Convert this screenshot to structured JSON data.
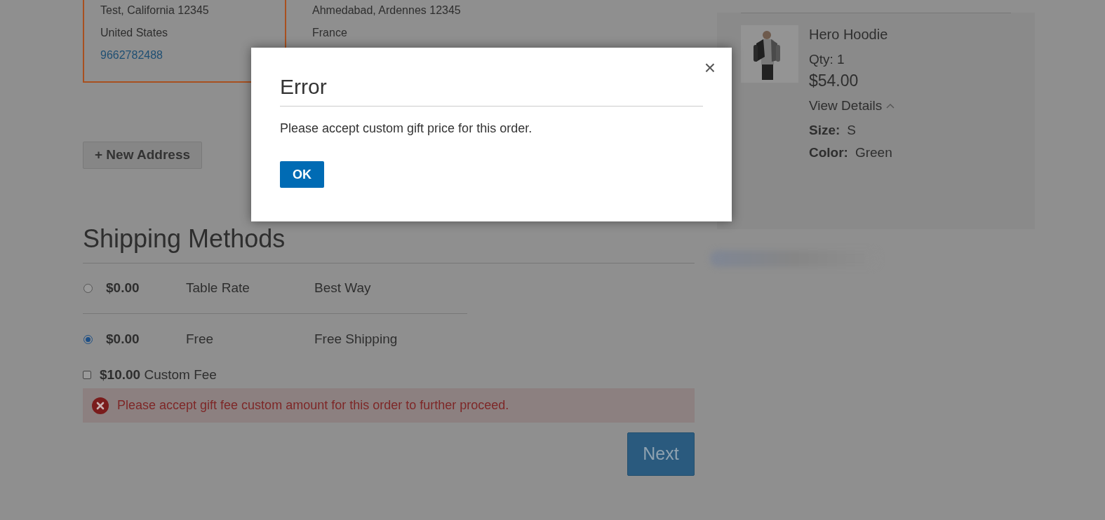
{
  "addresses": [
    {
      "lines": [
        "Test, California 12345",
        "United States"
      ],
      "phone": "9662782488",
      "selected": true
    },
    {
      "lines": [
        "Ahmedabad, Ardennes 12345",
        "France"
      ],
      "selected": false
    }
  ],
  "new_address_button": "+ New Address",
  "shipping": {
    "title": "Shipping Methods",
    "methods": [
      {
        "price": "$0.00",
        "carrier": "Table Rate",
        "method": "Best Way",
        "selected": false
      },
      {
        "price": "$0.00",
        "carrier": "Free",
        "method": "Free Shipping",
        "selected": true
      }
    ],
    "custom_fee": {
      "price": "$10.00",
      "label": "Custom Fee",
      "checked": false
    },
    "error": "Please accept gift fee custom amount for this order to further proceed.",
    "next_button": "Next"
  },
  "summary": {
    "item": {
      "name": "Hero Hoodie",
      "qty": "Qty: 1",
      "price": "$54.00",
      "details_toggle": "View Details",
      "expanded": true,
      "options": [
        {
          "label": "Size:",
          "value": "S"
        },
        {
          "label": "Color:",
          "value": "Green"
        }
      ]
    }
  },
  "modal": {
    "title": "Error",
    "message": "Please accept custom gift price for this order.",
    "ok_button": "OK",
    "close": "×"
  }
}
